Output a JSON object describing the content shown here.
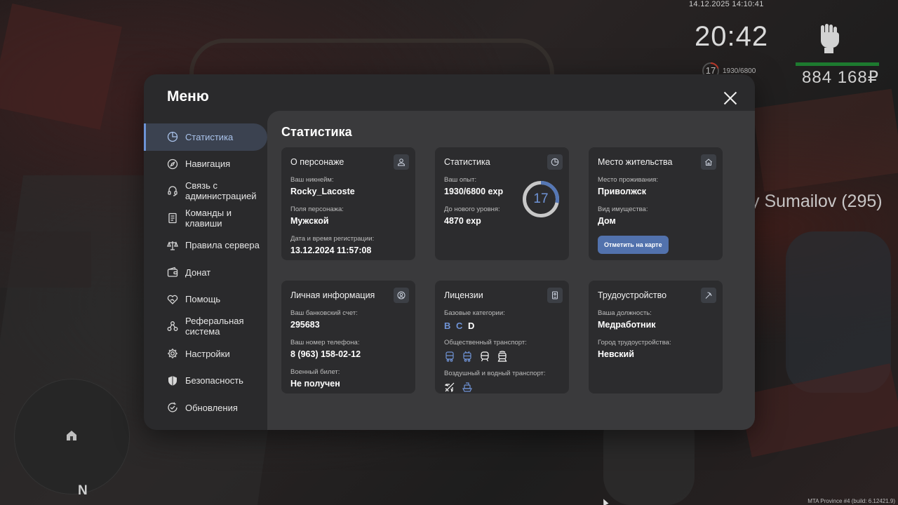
{
  "hud": {
    "datetime": "14.12.2025 14:10:41",
    "clock": "20:42",
    "level": "17",
    "exp": "1930/6800",
    "money": "884 168₽",
    "player_tag": "y Sumailov (295)",
    "compass": "N",
    "build": "MTA Province #4 (build: 6.12421.9)"
  },
  "menu": {
    "title": "Меню",
    "sidebar": [
      {
        "label": "Статистика",
        "icon": "pie-chart-icon",
        "active": true
      },
      {
        "label": "Навигация",
        "icon": "compass-icon"
      },
      {
        "label": "Связь с администрацией",
        "icon": "headset-icon"
      },
      {
        "label": "Команды и клавиши",
        "icon": "document-icon"
      },
      {
        "label": "Правила сервера",
        "icon": "scales-icon"
      },
      {
        "label": "Донат",
        "icon": "wallet-icon"
      },
      {
        "label": "Помощь",
        "icon": "heart-hand-icon"
      },
      {
        "label": "Реферальная система",
        "icon": "network-icon"
      },
      {
        "label": "Настройки",
        "icon": "gear-icon"
      },
      {
        "label": "Безопасность",
        "icon": "shield-icon"
      },
      {
        "label": "Обновления",
        "icon": "refresh-check-icon"
      }
    ]
  },
  "stats": {
    "title": "Статистика",
    "character": {
      "title": "О персонаже",
      "nick_label": "Ваш никнейм:",
      "nick": "Rocky_Lacoste",
      "gender_label": "Поля персонажа:",
      "gender": "Мужской",
      "reg_label": "Дата и время регистрации:",
      "reg": "13.12.2024 11:57:08"
    },
    "statistics": {
      "title": "Статистика",
      "exp_label": "Ваш опыт:",
      "exp": "1930/6800 exp",
      "next_label": "До нового уровня:",
      "next": "4870 exp",
      "level": "17",
      "progress": 0.284
    },
    "residence": {
      "title": "Место жительства",
      "place_label": "Место проживания:",
      "place": "Приволжск",
      "property_label": "Вид имущества:",
      "property": "Дом",
      "button": "Отметить на карте"
    },
    "personal": {
      "title": "Личная информация",
      "bank_label": "Ваш банковский счет:",
      "bank": "295683",
      "phone_label": "Ваш номер телефона:",
      "phone": "8 (963) 158-02-12",
      "military_label": "Военный билет:",
      "military": "Не получен"
    },
    "licenses": {
      "title": "Лицензии",
      "base_label": "Базовые категории:",
      "cat_b": "B",
      "cat_c": "C",
      "cat_d": "D",
      "public_label": "Общественный транспорт:",
      "air_label": "Воздушный и водный транспорт:"
    },
    "employment": {
      "title": "Трудоустройство",
      "position_label": "Ваша должность:",
      "position": "Медработник",
      "city_label": "Город трудоустройства:",
      "city": "Невский"
    }
  },
  "colors": {
    "accent": "#6f93d6",
    "button": "#5272ad",
    "panel": "#2a2a2c",
    "content": "#3a3a3c",
    "card": "#2c2c2e",
    "money_bar": "#1d7a2f"
  }
}
